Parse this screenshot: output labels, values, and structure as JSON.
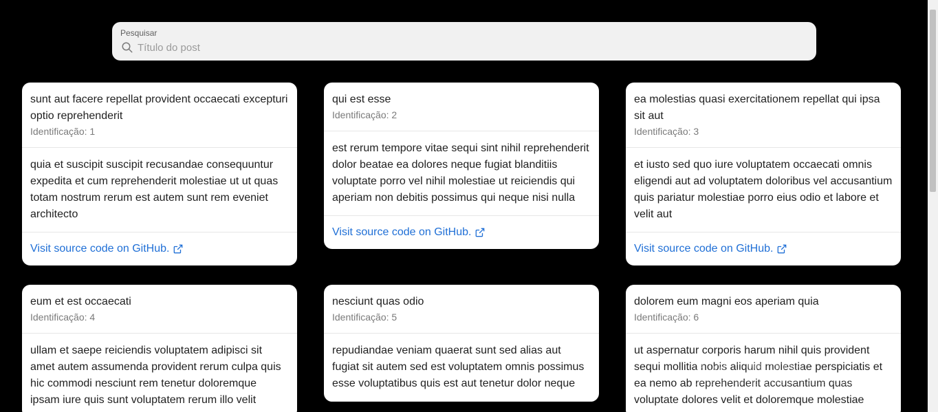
{
  "search": {
    "label": "Pesquisar",
    "placeholder": "Título do post",
    "value": ""
  },
  "link_label": "Visit source code on GitHub.",
  "posts": [
    {
      "title": "sunt aut facere repellat provident occaecati excepturi optio reprehenderit",
      "id_label": "Identificação: 1",
      "body": "quia et suscipit suscipit recusandae consequuntur expedita et cum reprehenderit molestiae ut ut quas totam nostrum rerum est autem sunt rem eveniet architecto"
    },
    {
      "title": "qui est esse",
      "id_label": "Identificação: 2",
      "body": "est rerum tempore vitae sequi sint nihil reprehenderit dolor beatae ea dolores neque fugiat blanditiis voluptate porro vel nihil molestiae ut reiciendis qui aperiam non debitis possimus qui neque nisi nulla"
    },
    {
      "title": "ea molestias quasi exercitationem repellat qui ipsa sit aut",
      "id_label": "Identificação: 3",
      "body": "et iusto sed quo iure voluptatem occaecati omnis eligendi aut ad voluptatem doloribus vel accusantium quis pariatur molestiae porro eius odio et labore et velit aut"
    },
    {
      "title": "eum et est occaecati",
      "id_label": "Identificação: 4",
      "body": "ullam et saepe reiciendis voluptatem adipisci sit amet autem assumenda provident rerum culpa quis hic commodi nesciunt rem tenetur doloremque ipsam iure quis sunt voluptatem rerum illo velit"
    },
    {
      "title": "nesciunt quas odio",
      "id_label": "Identificação: 5",
      "body": "repudiandae veniam quaerat sunt sed alias aut fugiat sit autem sed est voluptatem omnis possimus esse voluptatibus quis est aut tenetur dolor neque"
    },
    {
      "title": "dolorem eum magni eos aperiam quia",
      "id_label": "Identificação: 6",
      "body": "ut aspernatur corporis harum nihil quis provident sequi mollitia nobis aliquid molestiae perspiciatis et ea nemo ab reprehenderit accusantium quas voluptate dolores velit et doloremque molestiae"
    }
  ],
  "watermark": {
    "title": "Ativar o Windows",
    "subtitle": "Acesse Configurações para ativar o Windows."
  },
  "colors": {
    "background": "#000000",
    "card": "#ffffff",
    "link": "#1f6fd6",
    "search_bg": "#f1f1f1"
  },
  "icons": {
    "search": "search-icon",
    "external_link": "external-link-icon"
  }
}
